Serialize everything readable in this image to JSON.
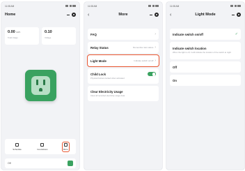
{
  "status_bar": {
    "time": "11:08 AM",
    "indicator": "4G"
  },
  "home": {
    "title": "Home",
    "stats": [
      {
        "value": "0.00",
        "unit": "kWh",
        "caption": "Total Usage"
      },
      {
        "value": "0.10",
        "unit": "",
        "caption": "Voltage"
      }
    ],
    "actions": [
      {
        "label": "Schedule",
        "icon": "clock-icon"
      },
      {
        "label": "Countdown",
        "icon": "timer-icon"
      },
      {
        "label": "More",
        "icon": "more-icon"
      }
    ],
    "bottom_label": "Off"
  },
  "menu": {
    "title": "More",
    "items": [
      {
        "label": "FAQ",
        "value": ""
      },
      {
        "label": "Relay Status",
        "value": "Remember last status"
      },
      {
        "label": "Light Mode",
        "value": "Indicate switch on/off"
      },
      {
        "label": "Child Lock",
        "desc": "Physical buttons locked when activated"
      },
      {
        "label": "Clear Electricity Usage",
        "desc": "Clear all recorded electricity usage data"
      }
    ]
  },
  "light_mode": {
    "title": "Light Mode",
    "options": [
      {
        "label": "Indicate switch on/off",
        "desc": ""
      },
      {
        "label": "Indicate switch location",
        "desc": "When the light is off, it will indicate the location of the switch at night"
      },
      {
        "label": "Off",
        "desc": ""
      },
      {
        "label": "On",
        "desc": ""
      }
    ]
  },
  "colors": {
    "accent": "#3aa260",
    "highlight": "#e8552f",
    "background": "#f2f3f6"
  }
}
